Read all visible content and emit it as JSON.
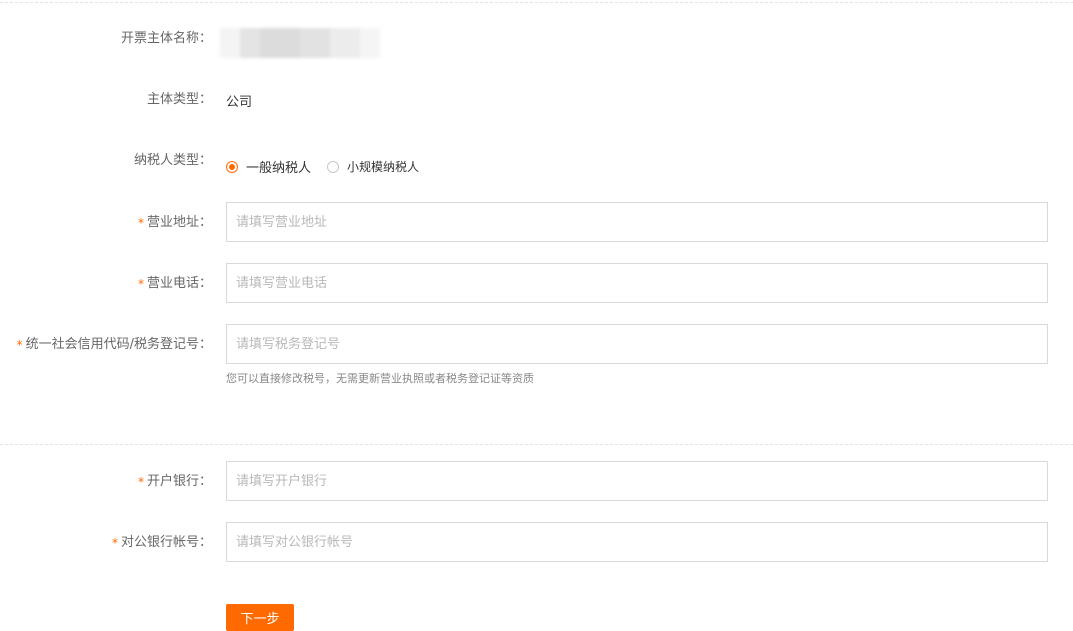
{
  "form": {
    "entity_name": {
      "label": "开票主体名称："
    },
    "entity_type": {
      "label": "主体类型：",
      "value": "公司"
    },
    "taxpayer_type": {
      "label": "纳税人类型：",
      "options": [
        {
          "label": "一般纳税人",
          "checked": true
        },
        {
          "label": "小规模纳税人",
          "checked": false
        }
      ]
    },
    "business_address": {
      "required_mark": "*",
      "label": "营业地址：",
      "value": "",
      "placeholder": "请填写营业地址"
    },
    "business_phone": {
      "required_mark": "*",
      "label": "营业电话：",
      "value": "",
      "placeholder": "请填写营业电话"
    },
    "tax_id": {
      "required_mark": "*",
      "label": "统一社会信用代码/税务登记号：",
      "value": "",
      "placeholder": "请填写税务登记号",
      "hint": "您可以直接修改税号，无需更新营业执照或者税务登记证等资质"
    },
    "bank_name": {
      "required_mark": "*",
      "label": "开户银行：",
      "value": "",
      "placeholder": "请填写开户银行"
    },
    "bank_account": {
      "required_mark": "*",
      "label": "对公银行帐号：",
      "value": "",
      "placeholder": "请填写对公银行帐号"
    }
  },
  "actions": {
    "next_label": "下一步"
  },
  "colors": {
    "accent": "#ff6a00",
    "label": "#666666",
    "placeholder": "#b8b8b8",
    "border": "#d9d9d9"
  }
}
